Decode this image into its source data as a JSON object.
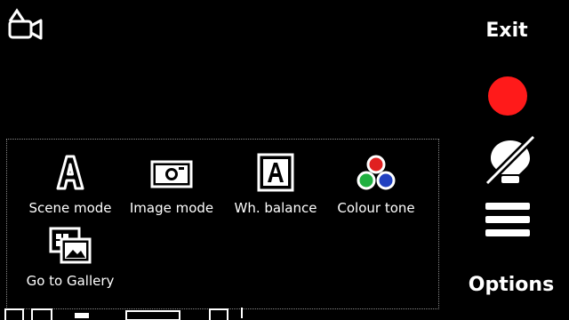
{
  "top": {
    "mode_icon": "video-camera-icon",
    "exit_label": "Exit"
  },
  "right": {
    "record_icon": "record-button-icon",
    "flash_icon": "flash-off-icon",
    "menu_icon": "menu-icon",
    "options_label": "Options",
    "record_color": "#ff1a1a"
  },
  "panel": {
    "items": [
      {
        "label": "Scene mode",
        "icon": "scene-auto-icon"
      },
      {
        "label": "Image mode",
        "icon": "camera-icon"
      },
      {
        "label": "Wh. balance",
        "icon": "white-balance-auto-icon"
      },
      {
        "label": "Colour tone",
        "icon": "colour-tone-icon"
      },
      {
        "label": "Go to Gallery",
        "icon": "gallery-icon"
      }
    ]
  }
}
